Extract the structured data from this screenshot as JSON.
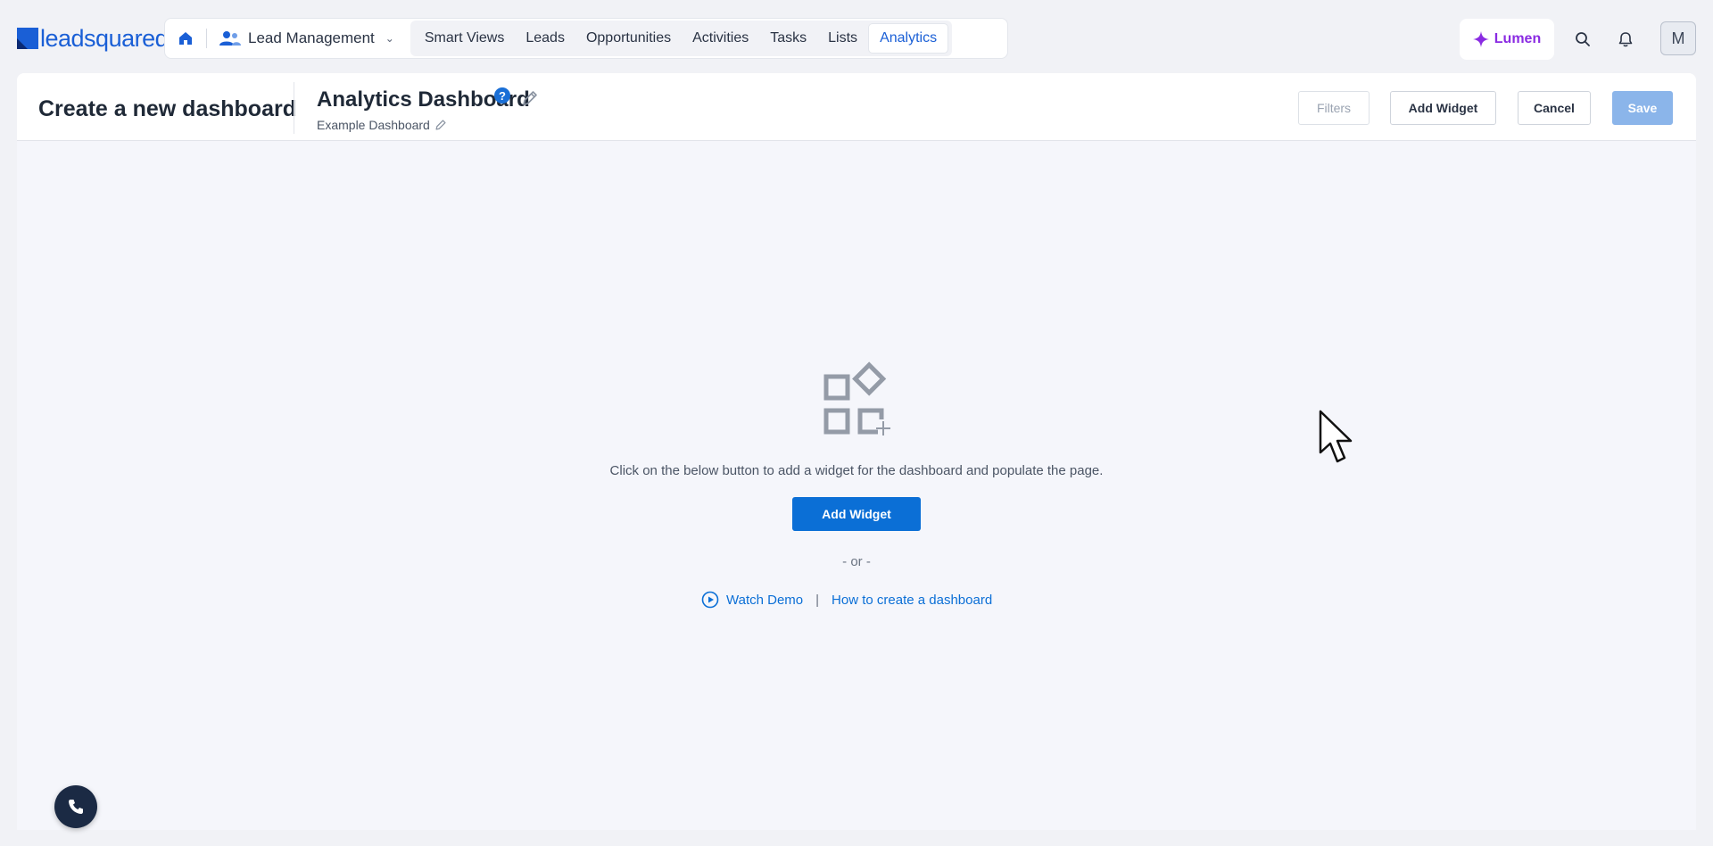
{
  "brand": {
    "logo_text": "leadsquared",
    "accent": "#1a5fd6"
  },
  "nav": {
    "module_label": "Lead Management",
    "tabs": [
      {
        "label": "Smart Views",
        "active": false
      },
      {
        "label": "Leads",
        "active": false
      },
      {
        "label": "Opportunities",
        "active": false
      },
      {
        "label": "Activities",
        "active": false
      },
      {
        "label": "Tasks",
        "active": false
      },
      {
        "label": "Lists",
        "active": false
      },
      {
        "label": "Analytics",
        "active": true
      }
    ],
    "lumen_label": "Lumen",
    "avatar_initial": "M"
  },
  "header": {
    "page_title": "Create a new dashboard",
    "dashboard_name": "Analytics Dashboard",
    "dashboard_subtitle": "Example Dashboard",
    "help_glyph": "?",
    "buttons": {
      "filters": "Filters",
      "add_widget": "Add Widget",
      "cancel": "Cancel",
      "save": "Save"
    }
  },
  "empty_state": {
    "message": "Click on the below button to add a widget for the dashboard and populate the page.",
    "add_widget": "Add Widget",
    "or_text": "- or -",
    "watch_demo": "Watch Demo",
    "separator": "|",
    "how_to": "How to create a dashboard"
  },
  "icons": [
    "home-icon",
    "users-icon",
    "chevron-down-icon",
    "sparkle-icon",
    "search-icon",
    "bell-icon",
    "help-icon",
    "pencil-icon",
    "widgets-icon",
    "play-circle-icon",
    "phone-icon",
    "cursor-icon"
  ]
}
